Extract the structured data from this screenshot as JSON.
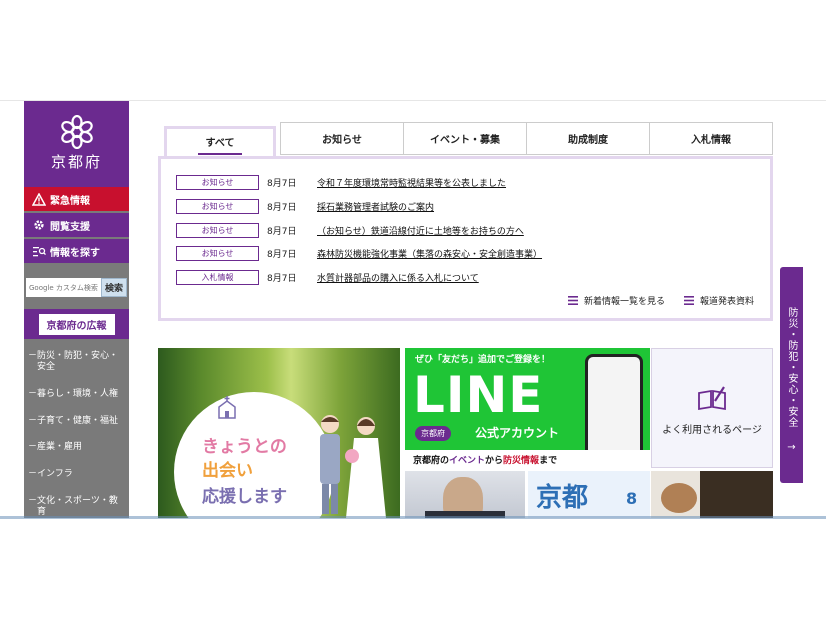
{
  "sidebar": {
    "site_name": "京都府",
    "emergency": "緊急情報",
    "reading_support": "閲覧支援",
    "find_info": "情報を探す",
    "search_placeholder": "Google カスタム検索",
    "search_button": "検索",
    "koho": "京都府の広報",
    "categories": [
      {
        "dash": "－",
        "label": "防災・防犯・安心・安全"
      },
      {
        "dash": "－",
        "label": "暮らし・環境・人権"
      },
      {
        "dash": "－",
        "label": "子育て・健康・福祉"
      },
      {
        "dash": "－",
        "label": "産業・雇用"
      },
      {
        "dash": "－",
        "label": "インフラ"
      },
      {
        "dash": "－",
        "label": "文化・スポーツ・教育"
      }
    ]
  },
  "news": {
    "tabs": [
      "すべて",
      "お知らせ",
      "イベント・募集",
      "助成制度",
      "入札情報"
    ],
    "active_tab": "すべて",
    "items": [
      {
        "badge": "お知らせ",
        "date": "8月7日",
        "title": "令和７年度環境常時監視結果等を公表しました"
      },
      {
        "badge": "お知らせ",
        "date": "8月7日",
        "title": "採石業務管理者試験のご案内"
      },
      {
        "badge": "お知らせ",
        "date": "8月7日",
        "title": "（お知らせ）鉄道沿線付近に土地等をお持ちの方へ"
      },
      {
        "badge": "お知らせ",
        "date": "8月7日",
        "title": "森林防災機能強化事業（集落の森安心・安全創造事業）"
      },
      {
        "badge": "入札情報",
        "date": "8月7日",
        "title": "水質計器部品の購入に係る入札について"
      }
    ],
    "more_news": "新着情報一覧を見る",
    "press_release": "報道発表資料"
  },
  "banners": {
    "wedding": [
      "きょうとの",
      "出会い",
      "応援します"
    ],
    "line_slogan": "ぜひ「友だち」追加でご登録を！",
    "line_big": "LINE",
    "line_badge": "京都府",
    "line_official": "公式アカウント",
    "line_bottom_a": "京都府の",
    "line_bottom_b": "イベント",
    "line_bottom_c": "から",
    "line_bottom_d": "防災情報",
    "line_bottom_e": "まで",
    "frequent_pages": "よく利用されるページ",
    "kyoto_mag_title": "京都",
    "kyoto_mag_month": "8"
  },
  "side_tab": {
    "label": "防災・防犯・安心・安全",
    "arrow": "→"
  },
  "colors": {
    "brand_purple": "#6b2a8f",
    "emergency_red": "#c8102e",
    "line_green": "#1fc536"
  }
}
